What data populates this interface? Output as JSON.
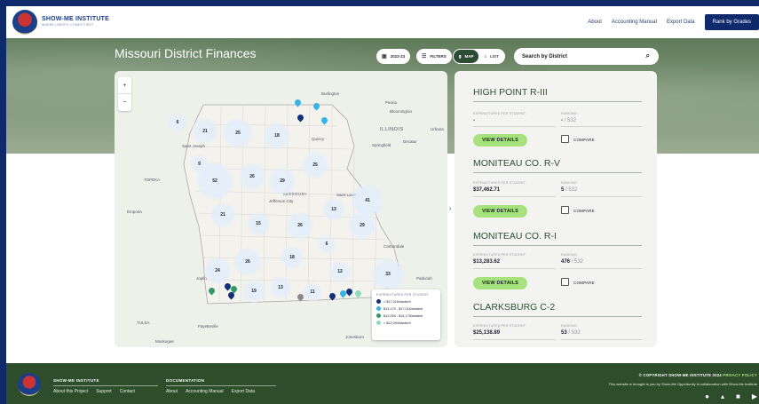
{
  "header": {
    "brand_name": "SHOW-ME INSTITUTE",
    "brand_tag": "WHERE LIBERTY COMES FIRST",
    "nav": [
      "About",
      "Accounting Manual",
      "Export Data"
    ],
    "rank_button": "Rank by Grades"
  },
  "page": {
    "title": "Missouri District Finances"
  },
  "controls": {
    "year": "2022-23",
    "filters": "FILTERS",
    "view_map": "MAP",
    "view_list": "LIST",
    "active_view": "MAP",
    "search_placeholder": "Search by District"
  },
  "map": {
    "labels": [
      "Burlington",
      "Peoria",
      "Bloomington",
      "ILLINOIS",
      "Urbana",
      "Springfield",
      "Decatur",
      "Quincy",
      "Saint Joseph",
      "TOPEKA",
      "MISSOURI",
      "Jefferson City",
      "Saint Louis",
      "Emporia",
      "Carbondale",
      "Paducah",
      "Joplin",
      "TULSA",
      "Fayetteville",
      "Jonesboro",
      "Muskogee"
    ],
    "clusters": [
      6,
      21,
      25,
      18,
      25,
      9,
      52,
      26,
      29,
      41,
      21,
      15,
      26,
      13,
      29,
      6,
      18,
      24,
      26,
      12,
      33,
      19,
      13,
      11
    ],
    "legend": {
      "title": "EXPENDITURES PER STUDENT",
      "items": [
        {
          "label": "> $17,016/student",
          "color": "#12307a"
        },
        {
          "label": "$14,179 - $17,016/student",
          "color": "#36b3e6"
        },
        {
          "label": "$12,094 - $14,178/student",
          "color": "#2f9a63"
        },
        {
          "label": "< $12,094/student",
          "color": "#8fdcb8"
        }
      ]
    }
  },
  "panel": {
    "expenditures_label": "EXPENDITURES PER STUDENT:",
    "ranking_label": "RANKING:",
    "view_details": "VIEW DETAILS",
    "compare": "COMPARE",
    "districts": [
      {
        "name": "HIGH POINT R-III",
        "expenditure": "-",
        "rank": "-",
        "of": "/ 532"
      },
      {
        "name": "MONITEAU CO. R-V",
        "expenditure": "$37,462.71",
        "rank": "5",
        "of": "/ 532"
      },
      {
        "name": "MONITEAU CO. R-I",
        "expenditure": "$13,283.62",
        "rank": "476",
        "of": "/ 532"
      },
      {
        "name": "CLARKSBURG C-2",
        "expenditure": "$25,138.89",
        "rank": "53",
        "of": "/ 532"
      }
    ]
  },
  "footer": {
    "col1_title": "SHOW-ME INSTITUTE",
    "col1_links": [
      "About this Project",
      "Support",
      "Contact"
    ],
    "col2_title": "DOCUMENTATION",
    "col2_links": [
      "About",
      "Accounting Manual",
      "Export Data"
    ],
    "copyright": "© COPYRIGHT SHOW-ME INSTITUTE 2024",
    "privacy": "PRIVACY POLICY",
    "note": "This website is brought to you by Show-Me Opportunity in collaboration with Show-Me Institute",
    "social": [
      "github-icon",
      "twitter-icon",
      "linkedin-icon",
      "youtube-icon"
    ]
  }
}
